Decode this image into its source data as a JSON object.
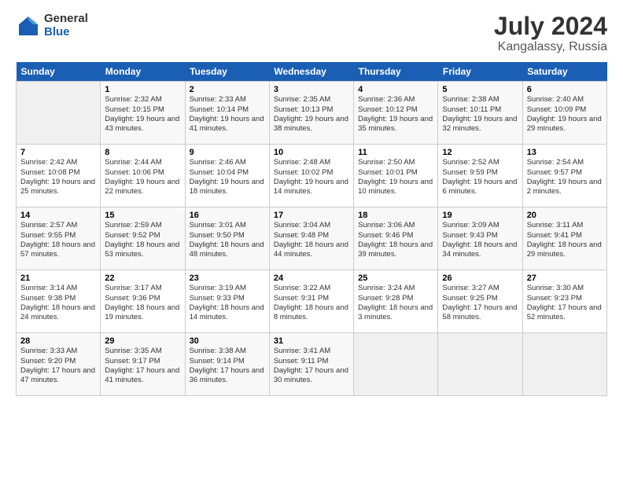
{
  "logo": {
    "general": "General",
    "blue": "Blue"
  },
  "title": {
    "month_year": "July 2024",
    "location": "Kangalassy, Russia"
  },
  "header_days": [
    "Sunday",
    "Monday",
    "Tuesday",
    "Wednesday",
    "Thursday",
    "Friday",
    "Saturday"
  ],
  "weeks": [
    [
      {
        "num": "",
        "info": ""
      },
      {
        "num": "1",
        "info": "Sunrise: 2:32 AM\nSunset: 10:15 PM\nDaylight: 19 hours\nand 43 minutes."
      },
      {
        "num": "2",
        "info": "Sunrise: 2:33 AM\nSunset: 10:14 PM\nDaylight: 19 hours\nand 41 minutes."
      },
      {
        "num": "3",
        "info": "Sunrise: 2:35 AM\nSunset: 10:13 PM\nDaylight: 19 hours\nand 38 minutes."
      },
      {
        "num": "4",
        "info": "Sunrise: 2:36 AM\nSunset: 10:12 PM\nDaylight: 19 hours\nand 35 minutes."
      },
      {
        "num": "5",
        "info": "Sunrise: 2:38 AM\nSunset: 10:11 PM\nDaylight: 19 hours\nand 32 minutes."
      },
      {
        "num": "6",
        "info": "Sunrise: 2:40 AM\nSunset: 10:09 PM\nDaylight: 19 hours\nand 29 minutes."
      }
    ],
    [
      {
        "num": "7",
        "info": "Sunrise: 2:42 AM\nSunset: 10:08 PM\nDaylight: 19 hours\nand 25 minutes."
      },
      {
        "num": "8",
        "info": "Sunrise: 2:44 AM\nSunset: 10:06 PM\nDaylight: 19 hours\nand 22 minutes."
      },
      {
        "num": "9",
        "info": "Sunrise: 2:46 AM\nSunset: 10:04 PM\nDaylight: 19 hours\nand 18 minutes."
      },
      {
        "num": "10",
        "info": "Sunrise: 2:48 AM\nSunset: 10:02 PM\nDaylight: 19 hours\nand 14 minutes."
      },
      {
        "num": "11",
        "info": "Sunrise: 2:50 AM\nSunset: 10:01 PM\nDaylight: 19 hours\nand 10 minutes."
      },
      {
        "num": "12",
        "info": "Sunrise: 2:52 AM\nSunset: 9:59 PM\nDaylight: 19 hours\nand 6 minutes."
      },
      {
        "num": "13",
        "info": "Sunrise: 2:54 AM\nSunset: 9:57 PM\nDaylight: 19 hours\nand 2 minutes."
      }
    ],
    [
      {
        "num": "14",
        "info": "Sunrise: 2:57 AM\nSunset: 9:55 PM\nDaylight: 18 hours\nand 57 minutes."
      },
      {
        "num": "15",
        "info": "Sunrise: 2:59 AM\nSunset: 9:52 PM\nDaylight: 18 hours\nand 53 minutes."
      },
      {
        "num": "16",
        "info": "Sunrise: 3:01 AM\nSunset: 9:50 PM\nDaylight: 18 hours\nand 48 minutes."
      },
      {
        "num": "17",
        "info": "Sunrise: 3:04 AM\nSunset: 9:48 PM\nDaylight: 18 hours\nand 44 minutes."
      },
      {
        "num": "18",
        "info": "Sunrise: 3:06 AM\nSunset: 9:46 PM\nDaylight: 18 hours\nand 39 minutes."
      },
      {
        "num": "19",
        "info": "Sunrise: 3:09 AM\nSunset: 9:43 PM\nDaylight: 18 hours\nand 34 minutes."
      },
      {
        "num": "20",
        "info": "Sunrise: 3:11 AM\nSunset: 9:41 PM\nDaylight: 18 hours\nand 29 minutes."
      }
    ],
    [
      {
        "num": "21",
        "info": "Sunrise: 3:14 AM\nSunset: 9:38 PM\nDaylight: 18 hours\nand 24 minutes."
      },
      {
        "num": "22",
        "info": "Sunrise: 3:17 AM\nSunset: 9:36 PM\nDaylight: 18 hours\nand 19 minutes."
      },
      {
        "num": "23",
        "info": "Sunrise: 3:19 AM\nSunset: 9:33 PM\nDaylight: 18 hours\nand 14 minutes."
      },
      {
        "num": "24",
        "info": "Sunrise: 3:22 AM\nSunset: 9:31 PM\nDaylight: 18 hours\nand 8 minutes."
      },
      {
        "num": "25",
        "info": "Sunrise: 3:24 AM\nSunset: 9:28 PM\nDaylight: 18 hours\nand 3 minutes."
      },
      {
        "num": "26",
        "info": "Sunrise: 3:27 AM\nSunset: 9:25 PM\nDaylight: 17 hours\nand 58 minutes."
      },
      {
        "num": "27",
        "info": "Sunrise: 3:30 AM\nSunset: 9:23 PM\nDaylight: 17 hours\nand 52 minutes."
      }
    ],
    [
      {
        "num": "28",
        "info": "Sunrise: 3:33 AM\nSunset: 9:20 PM\nDaylight: 17 hours\nand 47 minutes."
      },
      {
        "num": "29",
        "info": "Sunrise: 3:35 AM\nSunset: 9:17 PM\nDaylight: 17 hours\nand 41 minutes."
      },
      {
        "num": "30",
        "info": "Sunrise: 3:38 AM\nSunset: 9:14 PM\nDaylight: 17 hours\nand 36 minutes."
      },
      {
        "num": "31",
        "info": "Sunrise: 3:41 AM\nSunset: 9:11 PM\nDaylight: 17 hours\nand 30 minutes."
      },
      {
        "num": "",
        "info": ""
      },
      {
        "num": "",
        "info": ""
      },
      {
        "num": "",
        "info": ""
      }
    ]
  ]
}
